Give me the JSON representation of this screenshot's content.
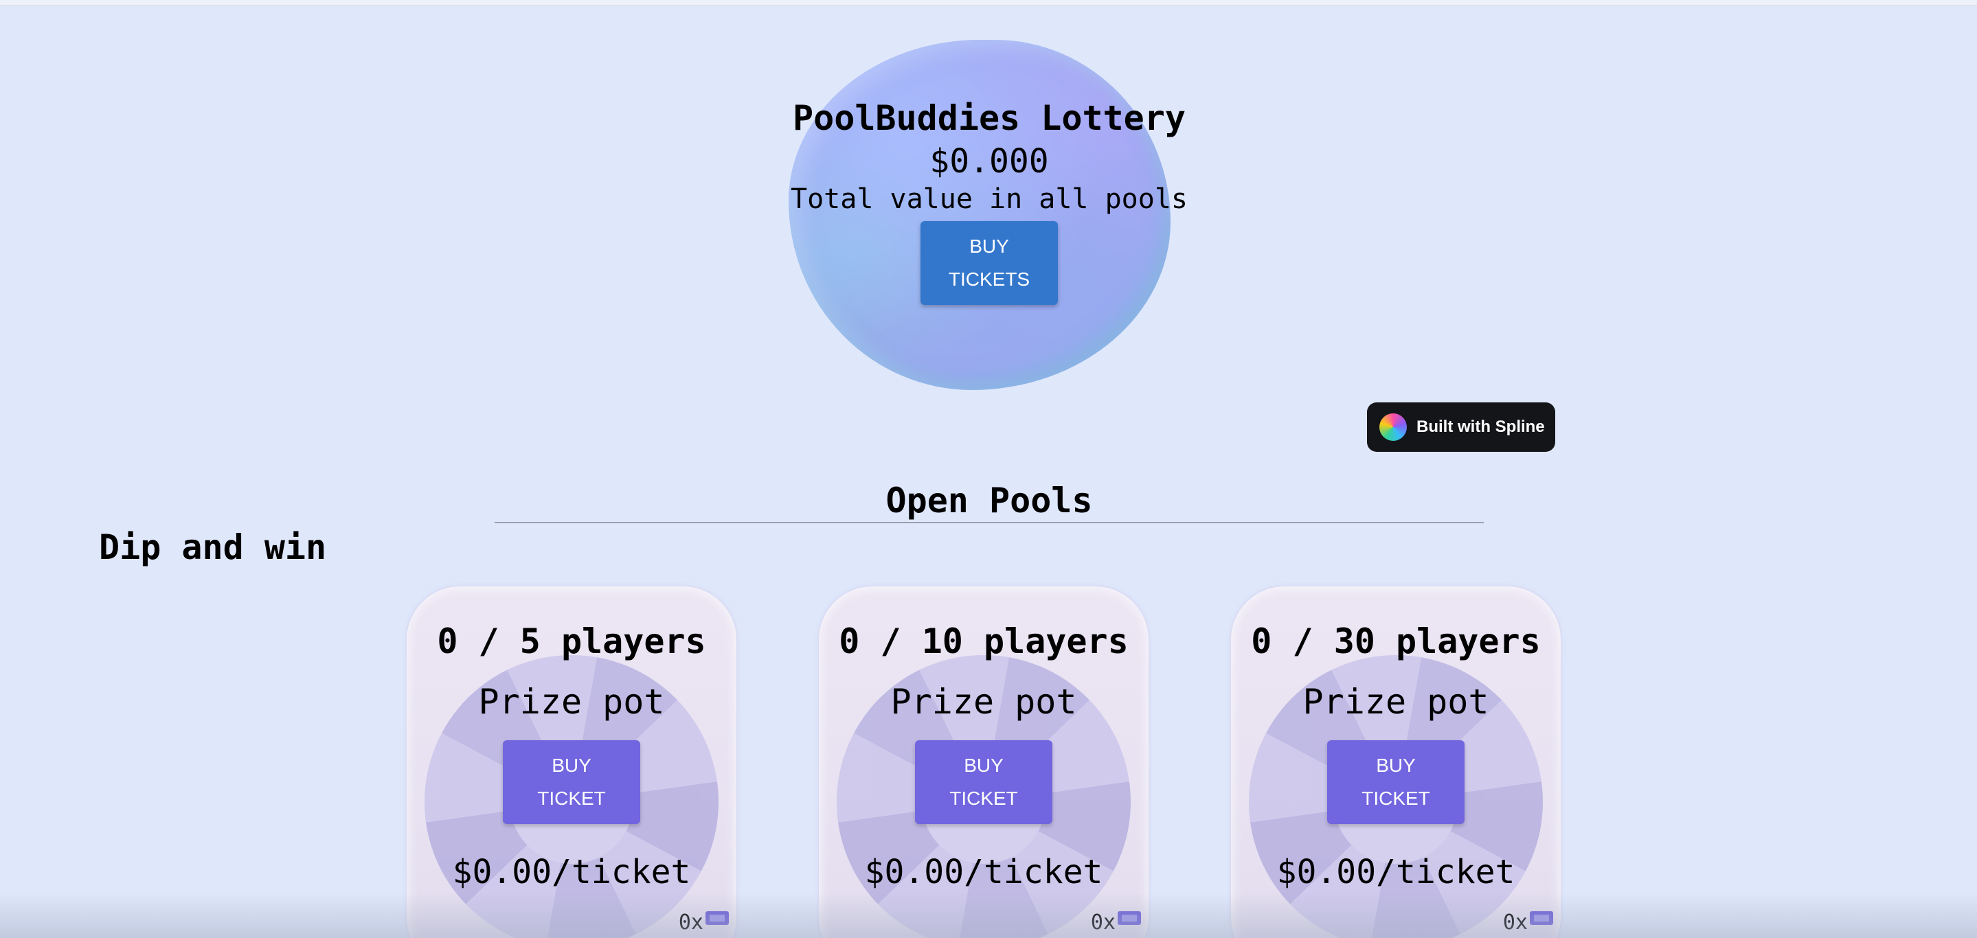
{
  "hero": {
    "title": "PoolBuddies Lottery",
    "value": "$0.000",
    "subtitle": "Total value in all pools",
    "button_line1": "BUY",
    "button_line2": "TICKETS"
  },
  "spline_badge": {
    "label": "Built with Spline"
  },
  "open_pools": {
    "title": "Open Pools"
  },
  "dip": {
    "title": "Dip and win"
  },
  "pools": [
    {
      "players": "0 / 5 players",
      "prize_label": "Prize pot",
      "button_line1": "BUY",
      "button_line2": "TICKET",
      "price": "$0.00/ticket",
      "count": "0x"
    },
    {
      "players": "0 / 10 players",
      "prize_label": "Prize pot",
      "button_line1": "BUY",
      "button_line2": "TICKET",
      "price": "$0.00/ticket",
      "count": "0x"
    },
    {
      "players": "0 / 30 players",
      "prize_label": "Prize pot",
      "button_line1": "BUY",
      "button_line2": "TICKET",
      "price": "$0.00/ticket",
      "count": "0x"
    }
  ],
  "colors": {
    "background": "#dfe7fb",
    "hero_button": "#3377cc",
    "pool_button": "#7166df",
    "ticket_icon": "#6b5fd8",
    "badge_bg": "#141518"
  }
}
